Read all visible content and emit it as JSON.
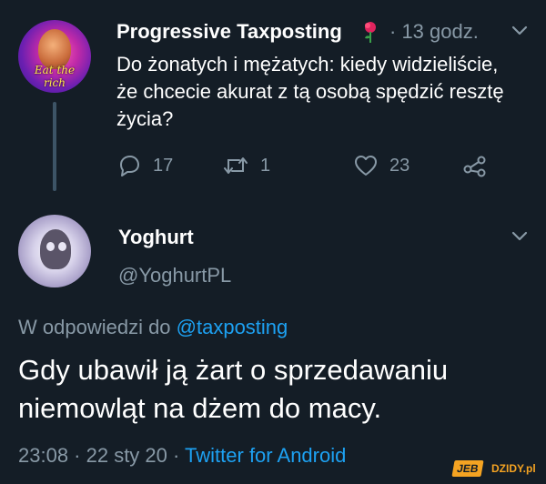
{
  "parent_tweet": {
    "author_name": "Progressive Taxposting",
    "avatar_caption": "Eat the rich",
    "time": "· 13 godz.",
    "text": "Do żonatych i mężatych: kiedy widzieliście, że chcecie akurat z tą osobą spędzić resztę życia?",
    "reply_count": "17",
    "retweet_count": "1",
    "like_count": "23"
  },
  "reply_tweet": {
    "author_name": "Yoghurt",
    "handle": "@YoghurtPL",
    "reply_to_prefix": "W odpowiedzi do ",
    "reply_to_handle": "@taxposting",
    "text": "Gdy ubawił ją żart o sprzedawaniu niemowląt na dżem do macy.",
    "timestamp": "23:08 · 22 sty 20 · ",
    "client": "Twitter for Android"
  },
  "watermark": {
    "left": "JEB",
    "right": "DZIDY.pl"
  },
  "colors": {
    "background": "#141d26",
    "secondary_text": "#8899a6",
    "link": "#1da1f2",
    "thread_line": "#3d5466"
  }
}
